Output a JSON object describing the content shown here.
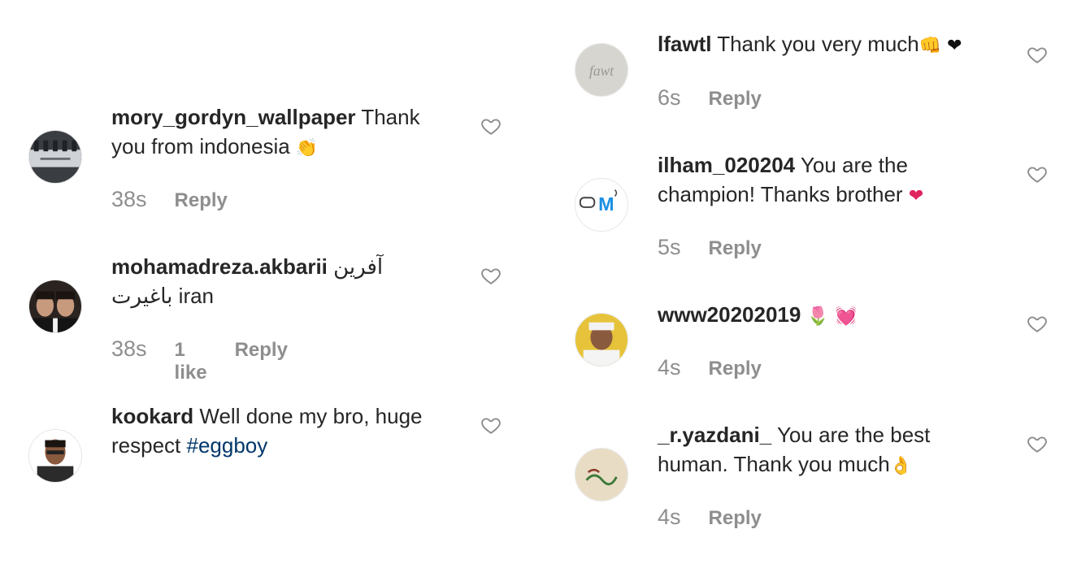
{
  "comments": [
    {
      "username": "mory_gordyn_wallpaper",
      "text_line1": "Thank",
      "text_line2": "you from indonesia",
      "emoji": "👏",
      "time": "38s",
      "reply": "Reply"
    },
    {
      "username": "mohamadreza.akbarii",
      "text_line1": "آفرین",
      "text_line2": "باغیرت iran",
      "time": "38s",
      "likes": "1 like",
      "reply": "Reply"
    },
    {
      "username": "kookard",
      "text_line1": "Well done my bro, huge",
      "text_line2_pre": "respect ",
      "hashtag": "#eggboy"
    },
    {
      "username": "lfawtl",
      "text_line1": "Thank you very much",
      "emoji": "👊 ❤",
      "time": "6s",
      "reply": "Reply"
    },
    {
      "username": "ilham_020204",
      "text_line1": "You are the",
      "text_line2": "champion! Thanks brother",
      "emoji": "❤",
      "time": "5s",
      "reply": "Reply"
    },
    {
      "username": "www20202019",
      "emoji": "🌷 💓",
      "time": "4s",
      "reply": "Reply"
    },
    {
      "username": "_r.yazdani_",
      "text_line1": "You are the best",
      "text_line2": "human. Thank you much",
      "emoji": "👌",
      "time": "4s",
      "reply": "Reply"
    }
  ],
  "avatars": {
    "c4_text": "fawt",
    "c5_text": "M"
  },
  "colors": {
    "text": "#262626",
    "muted": "#8e8e8e",
    "hashtag": "#00376b",
    "heart_emoji": "#e0245e",
    "clap_emoji": "#f5b400"
  }
}
